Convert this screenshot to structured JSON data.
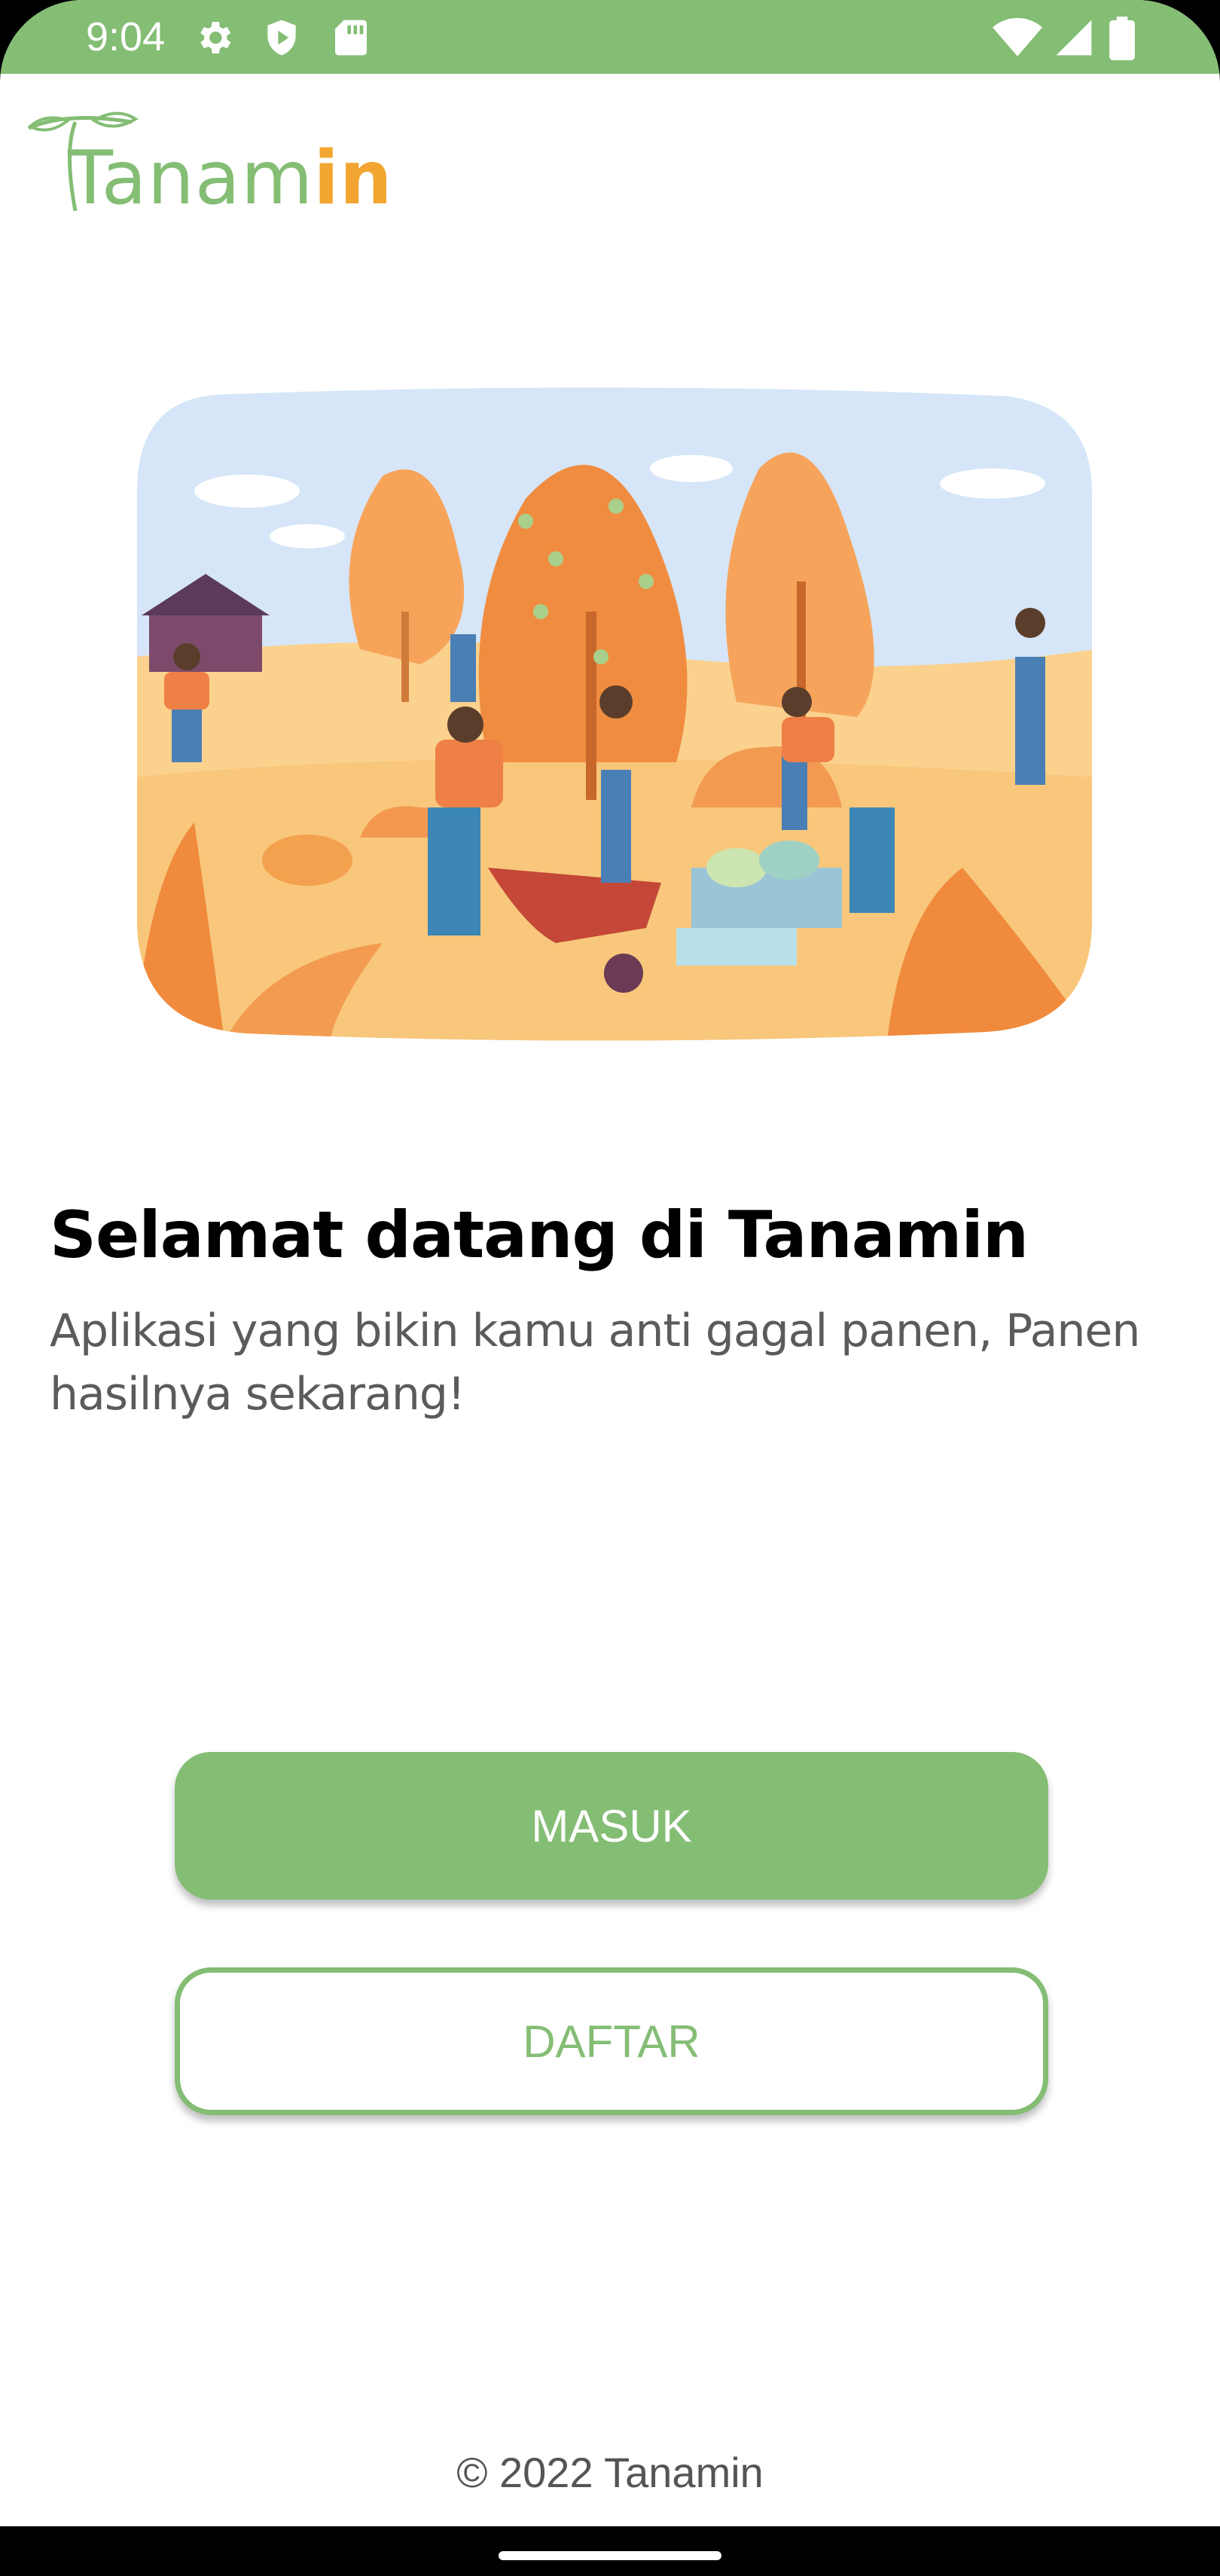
{
  "status_bar": {
    "time": "9:04",
    "left_icons": [
      "gear-icon",
      "play-protect-icon",
      "sd-card-icon"
    ],
    "right_icons": [
      "wifi-icon",
      "signal-icon",
      "battery-icon"
    ]
  },
  "logo": {
    "part_a": "Tanam",
    "part_b": "in"
  },
  "welcome": {
    "title": "Selamat datang di Tanamin",
    "subtitle": "Aplikasi yang bikin kamu anti gagal panen, Panen hasilnya sekarang!"
  },
  "buttons": {
    "login": "MASUK",
    "register": "DAFTAR"
  },
  "footer": {
    "copyright": "© 2022 Tanamin"
  },
  "colors": {
    "brand_green": "#84bd74",
    "brand_orange": "#f2a631"
  }
}
